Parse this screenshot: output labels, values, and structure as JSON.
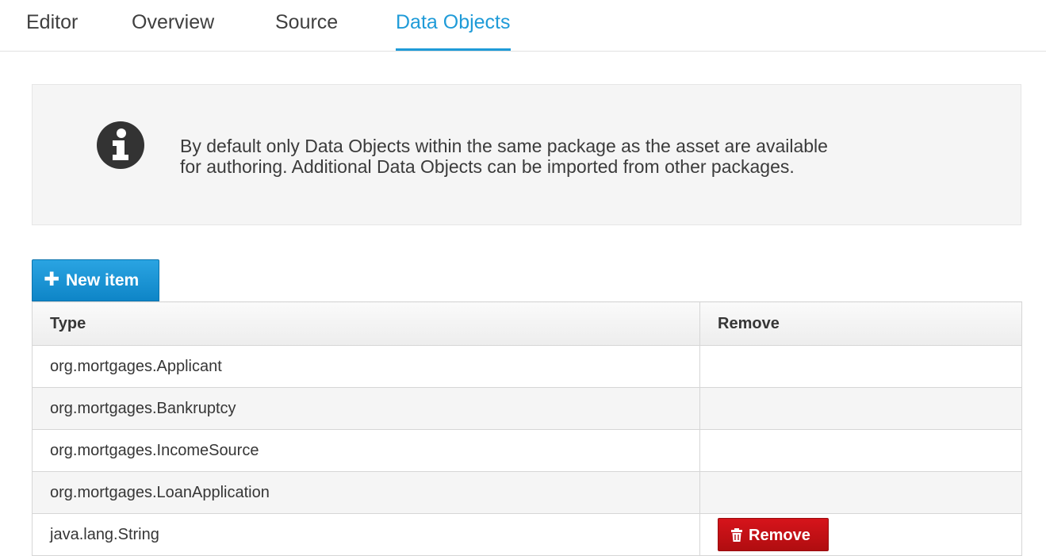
{
  "tabs": [
    {
      "label": "Editor"
    },
    {
      "label": "Overview"
    },
    {
      "label": "Source"
    },
    {
      "label": "Data Objects",
      "active": true
    }
  ],
  "info": {
    "icon": "info-circle-icon",
    "text_line1": "By default only Data Objects within the same package as the asset are available",
    "text_line2": "for authoring. Additional Data Objects can be imported from other packages."
  },
  "toolbar": {
    "new_item_label": "New item",
    "new_item_icon": "plus-icon"
  },
  "table": {
    "columns": [
      "Type",
      "Remove"
    ],
    "rows": [
      {
        "type": "org.mortgages.Applicant"
      },
      {
        "type": "org.mortgages.Bankruptcy"
      },
      {
        "type": "org.mortgages.IncomeSource"
      },
      {
        "type": "org.mortgages.LoanApplication"
      },
      {
        "type": "java.lang.String",
        "remove_label": "Remove",
        "remove_icon": "trash-icon"
      }
    ]
  },
  "colors": {
    "accent": "#1f9bd8",
    "primary_button": "#0e85c7",
    "danger_button": "#c41016"
  }
}
